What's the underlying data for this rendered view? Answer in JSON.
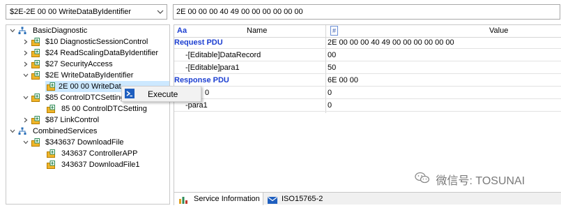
{
  "service_selector": {
    "value": "$2E-2E 00 00 WriteDataByIdentifier"
  },
  "hex_field": {
    "value": "2E 00 00 00 40 49 00 00 00 00 00 00"
  },
  "tree": {
    "items": [
      {
        "label": "BasicDiagnostic"
      },
      {
        "label": "$10 DiagnosticSessionControl"
      },
      {
        "label": "$24 ReadScalingDataByIdentifier"
      },
      {
        "label": "$27 SecurityAccess"
      },
      {
        "label": "$2E WriteDataByIdentifier"
      },
      {
        "label": "2E 00 00 WriteDat"
      },
      {
        "label": "$85 ControlDTCSetting"
      },
      {
        "label": "85 00 ControlDTCSetting"
      },
      {
        "label": "$87 LinkControl"
      },
      {
        "label": "CombinedServices"
      },
      {
        "label": "$343637 DownloadFile"
      },
      {
        "label": "343637 ControllerAPP"
      },
      {
        "label": "343637 DownloadFile1"
      }
    ]
  },
  "context_menu": {
    "execute_label": "Execute"
  },
  "grid": {
    "sort_icon_text": "Aa",
    "name_header": "Name",
    "hash_icon_text": "#",
    "value_header": "Value",
    "rows": [
      {
        "name": "Request PDU",
        "value": "2E 00 00 00 40 49 00 00 00 00 00 00"
      },
      {
        "name": "-[Editable]DataRecord",
        "value": "00"
      },
      {
        "name": "-[Editable]para1",
        "value": "50"
      },
      {
        "name": "Response PDU",
        "value": "6E 00 00"
      },
      {
        "name": "0",
        "value": "0"
      },
      {
        "name": "-para1",
        "value": "0"
      }
    ]
  },
  "tabs": [
    {
      "label": "Service Information"
    },
    {
      "label": "ISO15765-2"
    }
  ],
  "watermark": "微信号: TOSUNAI"
}
